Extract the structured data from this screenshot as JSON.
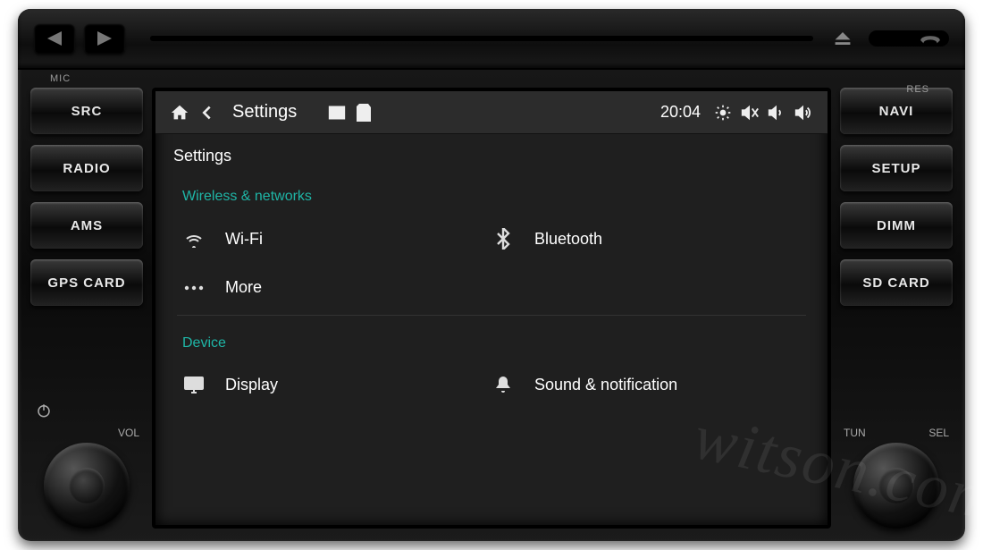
{
  "hardware": {
    "mic_label": "MIC",
    "res_label": "RES",
    "left_buttons": [
      "SRC",
      "RADIO",
      "AMS",
      "GPS CARD"
    ],
    "right_buttons": [
      "NAVI",
      "SETUP",
      "DIMM",
      "SD CARD"
    ],
    "left_knob": {
      "label_left": "",
      "label_right": "VOL",
      "power_icon": "power-icon"
    },
    "right_knob": {
      "label_left": "TUN",
      "label_right": "SEL"
    }
  },
  "statusbar": {
    "home_icon": "home-icon",
    "back_icon": "back-icon",
    "title": "Settings",
    "window_icon": "window-icon",
    "card_icon": "card-icon",
    "time": "20:04",
    "brightness_icon": "brightness-icon",
    "mute_icon": "mute-icon",
    "voldown_icon": "volume-down-icon",
    "volup_icon": "volume-up-icon"
  },
  "breadcrumb": "Settings",
  "sections": [
    {
      "title": "Wireless & networks",
      "rows": [
        {
          "left": {
            "icon": "wifi-icon",
            "label": "Wi-Fi"
          },
          "right": {
            "icon": "bluetooth-icon",
            "label": "Bluetooth"
          }
        },
        {
          "left": {
            "icon": "more-icon",
            "label": "More"
          },
          "right": null
        }
      ]
    },
    {
      "title": "Device",
      "rows": [
        {
          "left": {
            "icon": "display-icon",
            "label": "Display"
          },
          "right": {
            "icon": "bell-icon",
            "label": "Sound & notification"
          }
        }
      ]
    }
  ],
  "watermark": "witson.com"
}
